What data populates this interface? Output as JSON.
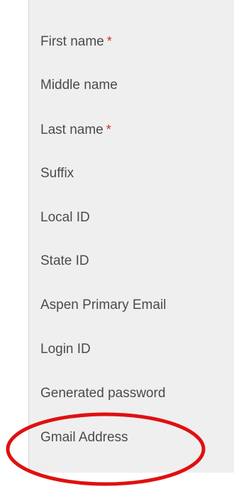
{
  "form": {
    "fields": [
      {
        "label": "First name",
        "required": true
      },
      {
        "label": "Middle name",
        "required": false
      },
      {
        "label": "Last name",
        "required": true
      },
      {
        "label": "Suffix",
        "required": false
      },
      {
        "label": "Local ID",
        "required": false
      },
      {
        "label": "State ID",
        "required": false
      },
      {
        "label": "Aspen Primary Email",
        "required": false
      },
      {
        "label": "Login ID",
        "required": false
      },
      {
        "label": "Generated password",
        "required": false
      },
      {
        "label": "Gmail Address",
        "required": false
      }
    ],
    "required_marker": "*"
  },
  "annotation": {
    "highlighted_field": "Gmail Address",
    "color": "#e01010"
  },
  "colors": {
    "panel_background": "#efefef",
    "label_text": "#4b4b4b",
    "required_marker": "#d32f2f"
  }
}
